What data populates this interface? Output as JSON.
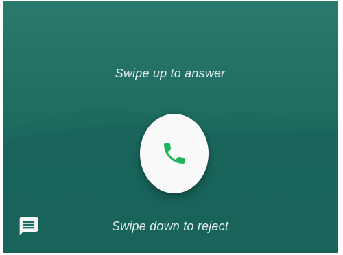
{
  "incoming_call": {
    "answer_hint": "Swipe up to answer",
    "reject_hint": "Swipe down to reject",
    "answer_button_icon": "phone-icon",
    "message_button_icon": "message-icon"
  },
  "colors": {
    "background": "#1f6c61",
    "answer_button": "#fafafa",
    "phone_icon": "#1fb55a",
    "hint_text": "#ffffff"
  }
}
